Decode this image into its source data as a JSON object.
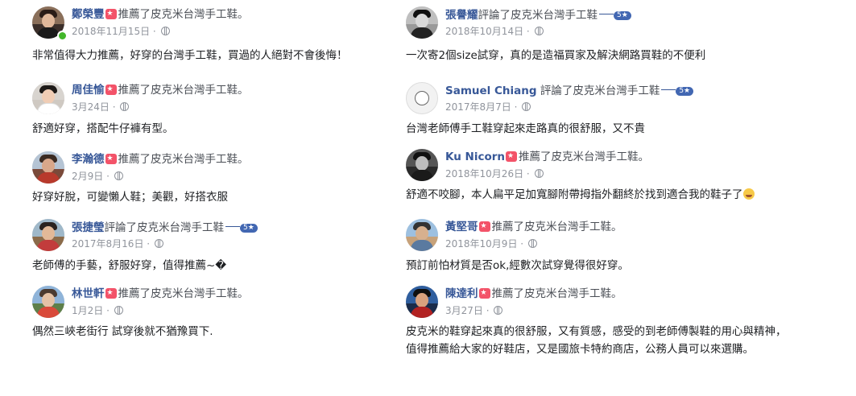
{
  "colors": {
    "name_link": "#385898",
    "recommend_badge": "#f35369",
    "meta": "#90949c",
    "rating_pill": "#4267b2"
  },
  "left_reviews": [
    {
      "name": "鄭榮豐",
      "action": "推薦了皮克米台灣手工鞋。",
      "date": "2018年11月15日",
      "text": "非常值得大力推薦，好穿的台灣手工鞋，買過的人絕對不會後悔！",
      "badge": "recommend-icon",
      "online": true
    },
    {
      "name": "周佳愉",
      "action": "推薦了皮克米台灣手工鞋。",
      "date": "3月24日",
      "text": "舒適好穿，搭配牛仔褲有型。",
      "badge": "recommend-icon"
    },
    {
      "name": "李瀚德",
      "action": "推薦了皮克米台灣手工鞋。",
      "date": "2月9日",
      "text": "好穿好脫，可變懶人鞋；美觀，好搭衣服",
      "badge": "recommend-icon"
    },
    {
      "name": "張捷瑩",
      "action": "評論了皮克米台灣手工鞋",
      "rating": "5★",
      "date": "2017年8月16日",
      "text": "老師傅的手藝，舒服好穿，值得推薦~�"
    },
    {
      "name": "林世軒",
      "action": "推薦了皮克米台灣手工鞋。",
      "date": "1月2日",
      "text": "偶然三峽老街行 試穿後就不猶豫買下.",
      "badge": "recommend-icon"
    }
  ],
  "right_reviews": [
    {
      "name": "張譽耀",
      "action": "評論了皮克米台灣手工鞋",
      "rating": "5★",
      "date": "2018年10月14日",
      "text": "一次寄2個size試穿，真的是造福買家及解決網路買鞋的不便利"
    },
    {
      "name": "Samuel Chiang",
      "action": "評論了皮克米台灣手工鞋",
      "rating": "5★",
      "date": "2017年8月7日",
      "text": "台灣老師傅手工鞋穿起來走路真的很舒服，又不貴"
    },
    {
      "name": "Ku Nicorn",
      "action": "推薦了皮克米台灣手工鞋。",
      "date": "2018年10月26日",
      "text": "舒適不咬腳，本人扁平足加寬腳附帶拇指外翻終於找到適合我的鞋子了",
      "badge": "recommend-icon",
      "emoji": "crying-face-emoji"
    },
    {
      "name": "黃堅哥",
      "action": "推薦了皮克米台灣手工鞋。",
      "date": "2018年10月9日",
      "text": "預訂前怕材質是否ok,經數次試穿覺得很好穿。",
      "badge": "recommend-icon"
    },
    {
      "name": "陳達利",
      "action": "推薦了皮克米台灣手工鞋。",
      "date": "3月27日",
      "text": "皮克米的鞋穿起來真的很舒服，又有質感，感受的到老師傅製鞋的用心與精神，",
      "text2": "值得推薦給大家的好鞋店，又是國旅卡特約商店，公務人員可以來選購。",
      "badge": "recommend-icon"
    }
  ]
}
